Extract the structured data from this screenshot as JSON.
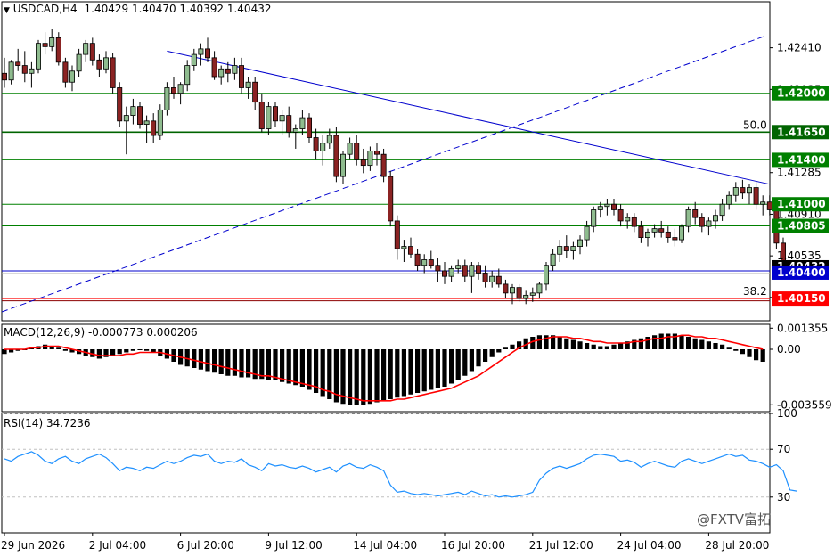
{
  "header": {
    "symbol": "USDCAD,H4",
    "ohlc": "1.40429 1.40470 1.40392 1.40432"
  },
  "macd_header": "MACD(12,26,9) -0.000773 0.000206",
  "rsi_header": "RSI(14) 34.7236",
  "watermark": "@FXTV富拓",
  "colors": {
    "bull": "#8fbc8f",
    "bear": "#8b2323",
    "line_green": "#008000",
    "line_blue": "#0000cd",
    "line_red": "#ff0000",
    "signal": "#ff0000",
    "rsi": "#1e90ff"
  },
  "chart_data": [
    {
      "type": "candlestick",
      "panel": "price",
      "y_ticks": [
        "1.42410",
        "1.42035",
        "1.41285",
        "1.40910",
        "1.40535",
        "1.40160"
      ],
      "ylim": [
        1.3995,
        1.4268
      ],
      "x_labels": [
        "29 Jun 2026",
        "2 Jul 04:00",
        "6 Jul 20:00",
        "9 Jul 12:00",
        "14 Jul 04:00",
        "16 Jul 20:00",
        "21 Jul 12:00",
        "24 Jul 04:00",
        "28 Jul 20:00"
      ],
      "horizontal_levels": [
        {
          "price": 1.42,
          "label": "1.42000",
          "color": "#008000",
          "tag": true
        },
        {
          "price": 1.4165,
          "label": "1.41650",
          "color": "#006400",
          "tag": true
        },
        {
          "price": 1.414,
          "label": "1.41400",
          "color": "#008000",
          "tag": true
        },
        {
          "price": 1.41,
          "label": "1.41000",
          "color": "#008000",
          "tag": true
        },
        {
          "price": 1.40805,
          "label": "1.40805",
          "color": "#008000",
          "tag": true
        },
        {
          "price": 1.404,
          "label": "1.40400",
          "color": "#0000cd",
          "tag": true
        },
        {
          "price": 1.4015,
          "label": "1.40150",
          "color": "#ff0000",
          "tag": true
        }
      ],
      "fib_labels": [
        "50.0",
        "38.2"
      ],
      "current_price": "1.40432",
      "candles": [
        [
          1.4218,
          1.4232,
          1.4205,
          1.4212
        ],
        [
          1.4212,
          1.423,
          1.4208,
          1.4228
        ],
        [
          1.4228,
          1.424,
          1.422,
          1.4225
        ],
        [
          1.4225,
          1.4238,
          1.421,
          1.4218
        ],
        [
          1.4218,
          1.4228,
          1.4205,
          1.4222
        ],
        [
          1.4222,
          1.4248,
          1.4218,
          1.4245
        ],
        [
          1.4245,
          1.4255,
          1.4235,
          1.4242
        ],
        [
          1.4242,
          1.4258,
          1.4238,
          1.425
        ],
        [
          1.425,
          1.4255,
          1.4225,
          1.4228
        ],
        [
          1.4228,
          1.4232,
          1.4205,
          1.421
        ],
        [
          1.421,
          1.4225,
          1.4202,
          1.422
        ],
        [
          1.422,
          1.424,
          1.4215,
          1.4235
        ],
        [
          1.4235,
          1.4248,
          1.4228,
          1.4245
        ],
        [
          1.4245,
          1.425,
          1.4225,
          1.423
        ],
        [
          1.423,
          1.4235,
          1.4215,
          1.4222
        ],
        [
          1.4222,
          1.4238,
          1.4218,
          1.4232
        ],
        [
          1.4232,
          1.4236,
          1.42,
          1.4205
        ],
        [
          1.4205,
          1.421,
          1.417,
          1.4175
        ],
        [
          1.4175,
          1.4188,
          1.4145,
          1.418
        ],
        [
          1.418,
          1.4195,
          1.4172,
          1.4188
        ],
        [
          1.4188,
          1.4192,
          1.4168,
          1.4172
        ],
        [
          1.4172,
          1.418,
          1.4155,
          1.4175
        ],
        [
          1.4175,
          1.4182,
          1.4155,
          1.4162
        ],
        [
          1.4162,
          1.419,
          1.4158,
          1.4185
        ],
        [
          1.4185,
          1.421,
          1.418,
          1.4205
        ],
        [
          1.4205,
          1.4215,
          1.4195,
          1.42
        ],
        [
          1.42,
          1.421,
          1.419,
          1.4208
        ],
        [
          1.4208,
          1.423,
          1.4202,
          1.4225
        ],
        [
          1.4225,
          1.424,
          1.422,
          1.4235
        ],
        [
          1.4235,
          1.4245,
          1.4225,
          1.424
        ],
        [
          1.424,
          1.425,
          1.4228,
          1.4232
        ],
        [
          1.4232,
          1.4238,
          1.4212,
          1.4215
        ],
        [
          1.4215,
          1.4225,
          1.4208,
          1.4222
        ],
        [
          1.4222,
          1.4228,
          1.421,
          1.4218
        ],
        [
          1.4218,
          1.4232,
          1.4212,
          1.4225
        ],
        [
          1.4225,
          1.4232,
          1.42,
          1.4205
        ],
        [
          1.4205,
          1.4215,
          1.4195,
          1.421
        ],
        [
          1.421,
          1.4215,
          1.4185,
          1.4192
        ],
        [
          1.4192,
          1.42,
          1.4165,
          1.4168
        ],
        [
          1.4168,
          1.4192,
          1.4162,
          1.4188
        ],
        [
          1.4188,
          1.4192,
          1.417,
          1.4175
        ],
        [
          1.4175,
          1.4185,
          1.4162,
          1.418
        ],
        [
          1.418,
          1.4188,
          1.416,
          1.4165
        ],
        [
          1.4165,
          1.4172,
          1.415,
          1.4168
        ],
        [
          1.4168,
          1.4185,
          1.4162,
          1.4178
        ],
        [
          1.4178,
          1.4182,
          1.4155,
          1.416
        ],
        [
          1.416,
          1.4168,
          1.414,
          1.4148
        ],
        [
          1.4148,
          1.4162,
          1.4135,
          1.4155
        ],
        [
          1.4155,
          1.4168,
          1.415,
          1.4162
        ],
        [
          1.4162,
          1.417,
          1.412,
          1.4125
        ],
        [
          1.4125,
          1.4148,
          1.4118,
          1.4145
        ],
        [
          1.4145,
          1.416,
          1.414,
          1.4155
        ],
        [
          1.4155,
          1.4162,
          1.4135,
          1.414
        ],
        [
          1.414,
          1.415,
          1.4128,
          1.4135
        ],
        [
          1.4135,
          1.4152,
          1.413,
          1.4148
        ],
        [
          1.4148,
          1.4155,
          1.4135,
          1.4145
        ],
        [
          1.4145,
          1.415,
          1.412,
          1.4125
        ],
        [
          1.4125,
          1.413,
          1.408,
          1.4085
        ],
        [
          1.4085,
          1.409,
          1.405,
          1.406
        ],
        [
          1.406,
          1.4068,
          1.4048,
          1.4062
        ],
        [
          1.4062,
          1.407,
          1.4052,
          1.4055
        ],
        [
          1.4055,
          1.406,
          1.404,
          1.4045
        ],
        [
          1.4045,
          1.4055,
          1.4038,
          1.405
        ],
        [
          1.405,
          1.4058,
          1.4042,
          1.4045
        ],
        [
          1.4045,
          1.4052,
          1.403,
          1.404
        ],
        [
          1.404,
          1.4048,
          1.4028,
          1.4035
        ],
        [
          1.4035,
          1.4045,
          1.403,
          1.4042
        ],
        [
          1.4042,
          1.405,
          1.4038,
          1.4045
        ],
        [
          1.4045,
          1.405,
          1.403,
          1.4035
        ],
        [
          1.4035,
          1.4048,
          1.402,
          1.4045
        ],
        [
          1.4045,
          1.4048,
          1.4032,
          1.4038
        ],
        [
          1.4038,
          1.4045,
          1.4025,
          1.403
        ],
        [
          1.403,
          1.404,
          1.4025,
          1.4035
        ],
        [
          1.4035,
          1.4042,
          1.4025,
          1.4028
        ],
        [
          1.4028,
          1.4032,
          1.4015,
          1.402
        ],
        [
          1.402,
          1.4028,
          1.401,
          1.4025
        ],
        [
          1.4025,
          1.4028,
          1.4012,
          1.4015
        ],
        [
          1.4015,
          1.4022,
          1.401,
          1.4018
        ],
        [
          1.4018,
          1.4025,
          1.4012,
          1.402
        ],
        [
          1.402,
          1.403,
          1.4015,
          1.4028
        ],
        [
          1.4028,
          1.4048,
          1.4022,
          1.4045
        ],
        [
          1.4045,
          1.406,
          1.404,
          1.4055
        ],
        [
          1.4055,
          1.4068,
          1.4048,
          1.4062
        ],
        [
          1.4062,
          1.4072,
          1.4052,
          1.4058
        ],
        [
          1.4058,
          1.4066,
          1.405,
          1.4062
        ],
        [
          1.4062,
          1.4072,
          1.4055,
          1.4068
        ],
        [
          1.4068,
          1.4085,
          1.4062,
          1.408
        ],
        [
          1.408,
          1.4098,
          1.4075,
          1.4095
        ],
        [
          1.4095,
          1.4102,
          1.4088,
          1.4098
        ],
        [
          1.4098,
          1.4105,
          1.409,
          1.41
        ],
        [
          1.41,
          1.4105,
          1.409,
          1.4095
        ],
        [
          1.4095,
          1.41,
          1.408,
          1.4085
        ],
        [
          1.4085,
          1.4092,
          1.4078,
          1.4088
        ],
        [
          1.4088,
          1.4092,
          1.4075,
          1.408
        ],
        [
          1.408,
          1.4085,
          1.4065,
          1.407
        ],
        [
          1.407,
          1.4078,
          1.4062,
          1.4075
        ],
        [
          1.4075,
          1.4082,
          1.407,
          1.4078
        ],
        [
          1.4078,
          1.4085,
          1.407,
          1.4075
        ],
        [
          1.4075,
          1.408,
          1.4065,
          1.407
        ],
        [
          1.407,
          1.4078,
          1.4062,
          1.4068
        ],
        [
          1.4068,
          1.4082,
          1.4065,
          1.408
        ],
        [
          1.408,
          1.4098,
          1.4075,
          1.4095
        ],
        [
          1.4095,
          1.4102,
          1.4082,
          1.4088
        ],
        [
          1.4088,
          1.4092,
          1.4075,
          1.408
        ],
        [
          1.408,
          1.4088,
          1.4072,
          1.4085
        ],
        [
          1.4085,
          1.4095,
          1.4078,
          1.409
        ],
        [
          1.409,
          1.4105,
          1.4085,
          1.41
        ],
        [
          1.41,
          1.4112,
          1.4095,
          1.4108
        ],
        [
          1.4108,
          1.412,
          1.4102,
          1.4115
        ],
        [
          1.4115,
          1.4122,
          1.4105,
          1.411
        ],
        [
          1.411,
          1.4118,
          1.41,
          1.4115
        ],
        [
          1.4115,
          1.412,
          1.4095,
          1.41
        ],
        [
          1.41,
          1.4108,
          1.409,
          1.4102
        ],
        [
          1.4102,
          1.4108,
          1.409,
          1.4095
        ],
        [
          1.4095,
          1.41,
          1.406,
          1.4065
        ],
        [
          1.4065,
          1.407,
          1.4035,
          1.404
        ],
        [
          1.404,
          1.4047,
          1.4039,
          1.4043
        ]
      ]
    },
    {
      "type": "histogram+line",
      "panel": "macd",
      "series_name": "MACD(12,26,9)",
      "y_ticks": [
        "0.001355",
        "0.00",
        "-0.003559"
      ],
      "ylim": [
        -0.004,
        0.0016
      ],
      "macd": [
        -0.0003,
        -0.0002,
        -0.0001,
        0.0,
        0.0001,
        0.0002,
        0.0003,
        0.0002,
        0.0001,
        -0.0001,
        -0.0002,
        -0.0003,
        -0.0004,
        -0.0005,
        -0.0006,
        -0.0005,
        -0.0004,
        -0.0003,
        -0.0002,
        -0.0001,
        0.0,
        -0.0001,
        -0.0002,
        -0.0004,
        -0.0006,
        -0.0008,
        -0.001,
        -0.0011,
        -0.0012,
        -0.0013,
        -0.0014,
        -0.0015,
        -0.0016,
        -0.0017,
        -0.0017,
        -0.0018,
        -0.0018,
        -0.0019,
        -0.0019,
        -0.002,
        -0.002,
        -0.0021,
        -0.0022,
        -0.0023,
        -0.0024,
        -0.0026,
        -0.0028,
        -0.003,
        -0.0032,
        -0.0034,
        -0.0035,
        -0.0036,
        -0.0036,
        -0.0036,
        -0.0035,
        -0.0034,
        -0.0033,
        -0.0032,
        -0.0031,
        -0.003,
        -0.0029,
        -0.0028,
        -0.0027,
        -0.0026,
        -0.0025,
        -0.0024,
        -0.0022,
        -0.002,
        -0.0017,
        -0.0014,
        -0.0011,
        -0.0008,
        -0.0005,
        -0.0002,
        0.0001,
        0.0003,
        0.0005,
        0.0007,
        0.0008,
        0.0009,
        0.0009,
        0.0009,
        0.0008,
        0.0007,
        0.0006,
        0.0005,
        0.0004,
        0.0003,
        0.0002,
        0.0002,
        0.0003,
        0.0004,
        0.0005,
        0.0006,
        0.0007,
        0.0008,
        0.0009,
        0.001,
        0.001,
        0.001,
        0.0009,
        0.0008,
        0.0007,
        0.0006,
        0.0005,
        0.0004,
        0.0003,
        0.0001,
        -0.0001,
        -0.0003,
        -0.0005,
        -0.0007,
        -0.0008
      ],
      "signal": [
        0.0,
        0.0,
        0.0,
        0.0,
        0.0001,
        0.0001,
        0.0002,
        0.0002,
        0.0002,
        0.0001,
        0.0,
        -0.0001,
        -0.0002,
        -0.0003,
        -0.0004,
        -0.0004,
        -0.0004,
        -0.0004,
        -0.0003,
        -0.0003,
        -0.0002,
        -0.0002,
        -0.0002,
        -0.0002,
        -0.0003,
        -0.0004,
        -0.0005,
        -0.0006,
        -0.0007,
        -0.0008,
        -0.0009,
        -0.001,
        -0.0011,
        -0.0012,
        -0.0013,
        -0.0014,
        -0.0015,
        -0.0016,
        -0.0017,
        -0.0017,
        -0.0018,
        -0.0019,
        -0.002,
        -0.0021,
        -0.0022,
        -0.0023,
        -0.0024,
        -0.0026,
        -0.0027,
        -0.0029,
        -0.003,
        -0.0031,
        -0.0032,
        -0.0033,
        -0.0033,
        -0.0033,
        -0.0033,
        -0.0033,
        -0.0032,
        -0.0032,
        -0.0031,
        -0.003,
        -0.0029,
        -0.0028,
        -0.0027,
        -0.0026,
        -0.0025,
        -0.0023,
        -0.0021,
        -0.0019,
        -0.0017,
        -0.0014,
        -0.0011,
        -0.0008,
        -0.0005,
        -0.0002,
        0.0001,
        0.0003,
        0.0005,
        0.0006,
        0.0007,
        0.0008,
        0.0008,
        0.0008,
        0.0007,
        0.0007,
        0.0006,
        0.0005,
        0.0005,
        0.0004,
        0.0004,
        0.0004,
        0.0004,
        0.0005,
        0.0005,
        0.0006,
        0.0007,
        0.0007,
        0.0008,
        0.0008,
        0.0009,
        0.0009,
        0.0008,
        0.0008,
        0.0007,
        0.0007,
        0.0006,
        0.0005,
        0.0004,
        0.0003,
        0.0002,
        0.0001,
        0.0
      ]
    },
    {
      "type": "line",
      "panel": "rsi",
      "series_name": "RSI(14)",
      "y_ticks": [
        "100",
        "70",
        "30"
      ],
      "ylim": [
        0,
        100
      ],
      "levels": [
        70,
        30
      ],
      "values": [
        62,
        60,
        64,
        66,
        68,
        65,
        60,
        58,
        62,
        64,
        60,
        58,
        62,
        64,
        66,
        63,
        58,
        52,
        55,
        54,
        52,
        55,
        54,
        57,
        60,
        58,
        60,
        63,
        65,
        64,
        66,
        60,
        58,
        60,
        59,
        62,
        57,
        55,
        52,
        58,
        56,
        57,
        55,
        54,
        56,
        54,
        51,
        53,
        55,
        51,
        56,
        58,
        55,
        54,
        57,
        55,
        52,
        40,
        34,
        35,
        33,
        32,
        33,
        32,
        31,
        32,
        33,
        34,
        32,
        35,
        33,
        31,
        32,
        30,
        31,
        30,
        31,
        32,
        34,
        44,
        50,
        54,
        56,
        54,
        56,
        58,
        62,
        65,
        66,
        65,
        64,
        60,
        61,
        59,
        55,
        58,
        60,
        58,
        56,
        55,
        60,
        62,
        60,
        58,
        60,
        62,
        64,
        66,
        64,
        65,
        61,
        60,
        58,
        55,
        57,
        52,
        36,
        35
      ]
    }
  ]
}
